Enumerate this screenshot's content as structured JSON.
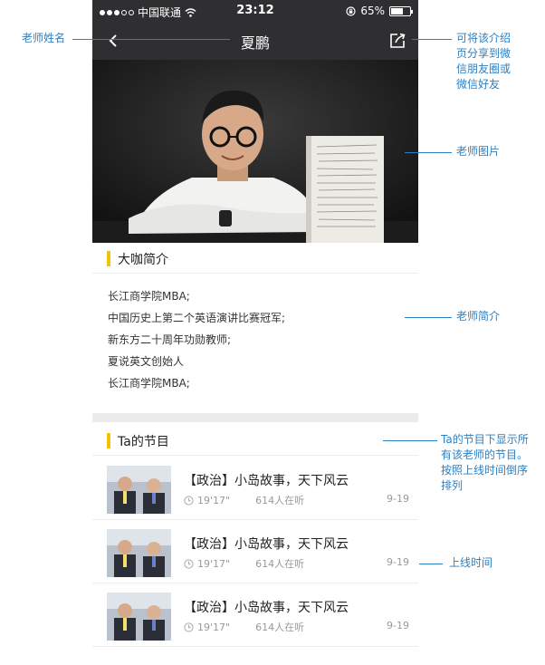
{
  "status_bar": {
    "carrier": "中国联通",
    "time": "23:12",
    "battery_text": "65%",
    "battery_level": 0.65
  },
  "nav": {
    "title": "夏鹏"
  },
  "sections": {
    "intro_title": "大咖简介",
    "programs_title": "Ta的节目"
  },
  "intro_lines": [
    "长江商学院MBA;",
    "中国历史上第二个英语演讲比赛冠军;",
    "新东方二十周年功勋教师;",
    "夏说英文创始人",
    "长江商学院MBA;"
  ],
  "programs": [
    {
      "title": "【政治】小岛故事，天下风云",
      "duration": "19'17\"",
      "listeners": "614人在听",
      "date": "9-19"
    },
    {
      "title": "【政治】小岛故事，天下风云",
      "duration": "19'17\"",
      "listeners": "614人在听",
      "date": "9-19"
    },
    {
      "title": "【政治】小岛故事，天下风云",
      "duration": "19'17\"",
      "listeners": "614人在听",
      "date": "9-19"
    }
  ],
  "annotations": {
    "teacher_name": "老师姓名",
    "share": [
      "可将该介绍",
      "页分享到微",
      "信朋友圈或",
      "微信好友"
    ],
    "teacher_photo": "老师图片",
    "teacher_intro": "老师简介",
    "programs_note": [
      "Ta的节目下显示所",
      "有该老师的节目。",
      "按照上线时间倒序",
      "排列"
    ],
    "online_time": "上线时间"
  },
  "colors": {
    "header_bg": "#2f2f31",
    "accent_yellow": "#f2c300",
    "annotation_blue": "#2b7fc2"
  },
  "icons": {
    "back": "chevron-left-icon",
    "share": "share-icon",
    "clock": "clock-icon",
    "wifi": "wifi-icon",
    "lock": "rotation-lock-icon"
  }
}
